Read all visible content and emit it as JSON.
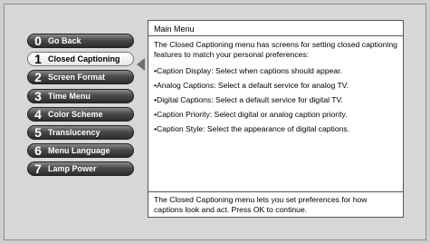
{
  "menu": {
    "items": [
      {
        "number": "0",
        "label": "Go Back"
      },
      {
        "number": "1",
        "label": "Closed Captioning"
      },
      {
        "number": "2",
        "label": "Screen Format"
      },
      {
        "number": "3",
        "label": "Time Menu"
      },
      {
        "number": "4",
        "label": "Color Scheme"
      },
      {
        "number": "5",
        "label": "Translucency"
      },
      {
        "number": "6",
        "label": "Menu Language"
      },
      {
        "number": "7",
        "label": "Lamp Power"
      }
    ],
    "selected_index": 1
  },
  "panel": {
    "title": "Main Menu",
    "intro": "The Closed Captioning menu has screens for setting closed captioning features to match your personal preferences:",
    "bullets": [
      "•Caption Display: Select when captions should appear.",
      "•Analog Captions: Select a default service for analog TV.",
      "•Digital Captions: Select a default service for digital TV.",
      "•Caption Priority: Select digital or analog caption priority.",
      "•Caption Style: Select the appearance of digital captions."
    ],
    "footer": "The Closed Captioning menu lets you set preferences for how captions look and act. Press OK to continue."
  }
}
